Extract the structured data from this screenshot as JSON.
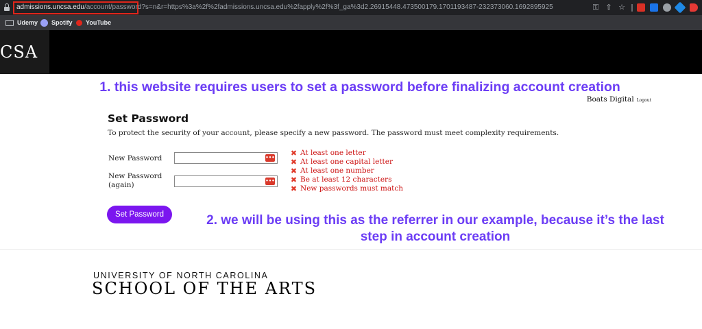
{
  "browser": {
    "url_host": "admissions.uncsa.edu",
    "url_rest": "/account/password?s=n&r=https%3a%2f%2fadmissions.uncsa.edu%2fapply%2f%3f_ga%3d2.26915448.473500179.1701193487-232373060.1692895925",
    "highlight_color": "#e0261b",
    "bookmarks": [
      {
        "label": "Udemy",
        "icon": "folder-icon"
      },
      {
        "label": "Spotify",
        "icon": "spotify-icon"
      },
      {
        "label": "YouTube",
        "icon": "youtube-icon"
      }
    ]
  },
  "header": {
    "logo_text": "CSA"
  },
  "annotations": {
    "note1": "1. this website requires users to set a password before finalizing account creation",
    "note2": "2. we will be using this as the referrer in our example, because it’s the last step in account creation",
    "color": "#6c3df5"
  },
  "user": {
    "name": "Boats Digital",
    "logout_label": "Logout"
  },
  "form": {
    "title": "Set Password",
    "description": "To protect the security of your account, please specify a new password. The password must meet complexity requirements.",
    "new_password_label": "New Password",
    "new_password_again_label": "New Password (again)",
    "requirements": [
      "At least one letter",
      "At least one capital letter",
      "At least one number",
      "Be at least 12 characters",
      "New passwords must match"
    ],
    "requirement_color": "#cc1111",
    "submit_label": "Set Password",
    "submit_color": "#7b16ef"
  },
  "footer": {
    "line1": "UNIVERSITY OF NORTH CAROLINA",
    "line2": "SCHOOL OF THE ARTS"
  }
}
